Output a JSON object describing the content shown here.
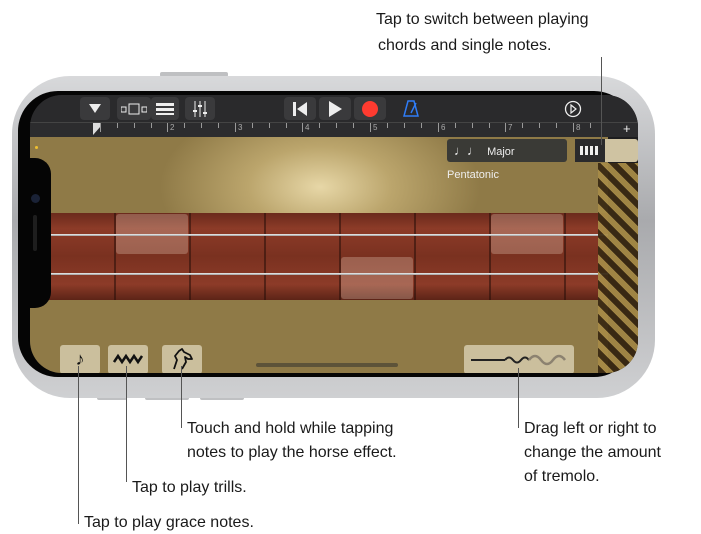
{
  "callouts": {
    "switch_line1": "Tap to switch between playing",
    "switch_line2": "chords and single notes.",
    "horse_line1": "Touch and hold while tapping",
    "horse_line2": "notes to play the horse effect.",
    "trills": "Tap to play trills.",
    "grace": "Tap to play grace notes.",
    "tremolo_line1": "Drag left or right to",
    "tremolo_line2": "change the amount",
    "tremolo_line3": "of tremolo."
  },
  "toolbar": {
    "browser_icon": "triangle-down-icon",
    "view_icon": "view-toggle-icon",
    "tracks_icon": "tracks-icon",
    "mixer_icon": "mixer-icon",
    "rewind_icon": "skip-back-icon",
    "play_icon": "play-icon",
    "record_icon": "record-icon",
    "metronome_icon": "metronome-icon",
    "settings_icon": "settings-icon",
    "record_color": "#ff3b30",
    "metronome_color": "#2f7cf6"
  },
  "ruler": {
    "bars": [
      "2",
      "3",
      "4",
      "5",
      "6",
      "7",
      "8"
    ],
    "add_label": "+"
  },
  "instrument": {
    "scale_label": "Major Pentatonic",
    "scale_icon_text": "♩♩",
    "mode_icon": "chord-strips-icon",
    "grace_icon_text": "♪",
    "trill_icon": "trill-icon",
    "horse_icon": "horse-icon",
    "tremolo_icon": "tremolo-icon"
  }
}
